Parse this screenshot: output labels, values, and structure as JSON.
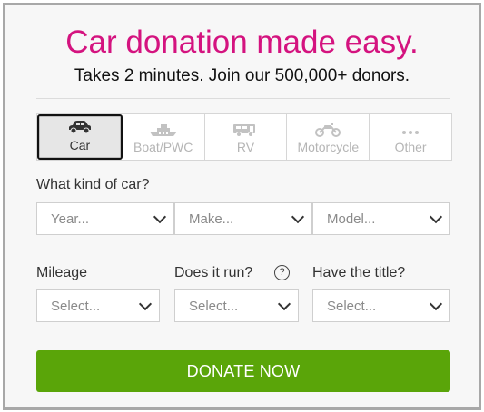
{
  "header": {
    "title": "Car donation made easy.",
    "subtitle": "Takes 2 minutes. Join our 500,000+ donors."
  },
  "vehicle_types": [
    {
      "label": "Car",
      "icon": "car-icon",
      "selected": true
    },
    {
      "label": "Boat/PWC",
      "icon": "boat-icon",
      "selected": false
    },
    {
      "label": "RV",
      "icon": "rv-icon",
      "selected": false
    },
    {
      "label": "Motorcycle",
      "icon": "motorcycle-icon",
      "selected": false
    },
    {
      "label": "Other",
      "icon": "more-dots-icon",
      "selected": false
    }
  ],
  "car_section": {
    "question": "What kind of car?",
    "year_placeholder": "Year...",
    "make_placeholder": "Make...",
    "model_placeholder": "Model..."
  },
  "details": {
    "mileage_label": "Mileage",
    "runs_label": "Does it run?",
    "help_glyph": "?",
    "title_label": "Have the title?",
    "mileage_value": "Select...",
    "runs_value": "Select...",
    "title_value": "Select..."
  },
  "cta": {
    "label": "DONATE NOW"
  },
  "colors": {
    "headline": "#d4137f",
    "button": "#5aa509",
    "frame_border": "#a8a8a8"
  }
}
